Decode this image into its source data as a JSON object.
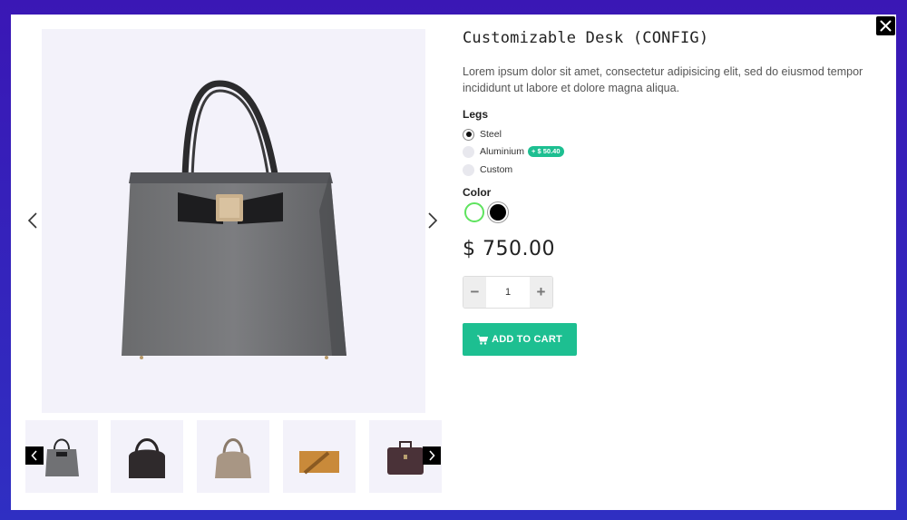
{
  "product": {
    "title": "Customizable Desk (CONFIG)",
    "description": "Lorem ipsum dolor sit amet, consectetur adipisicing elit, sed do eiusmod tempor incididunt ut labore et dolore magna aliqua.",
    "price": "$ 750.00"
  },
  "legs": {
    "label": "Legs",
    "options": [
      {
        "label": "Steel",
        "selected": true
      },
      {
        "label": "Aluminium",
        "badge": "+ $ 50.40",
        "selected": false
      },
      {
        "label": "Custom",
        "selected": false
      }
    ]
  },
  "color": {
    "label": "Color",
    "swatches": [
      {
        "name": "white",
        "hex": "#ffffff",
        "selected": true
      },
      {
        "name": "black",
        "hex": "#000000",
        "selected": false
      }
    ]
  },
  "quantity": {
    "minus": "−",
    "plus": "+",
    "value": "1"
  },
  "cart": {
    "label": "ADD TO CART"
  },
  "colors": {
    "accent": "#1dbf91",
    "background": "#3a17b5"
  },
  "icons": {
    "close": "close-icon",
    "prev": "chevron-left-icon",
    "next": "chevron-right-icon",
    "cart": "cart-icon"
  },
  "thumbnails": [
    "gray-tote-bag",
    "black-hobo-bag",
    "beige-hobo-bag",
    "tan-messenger-bag",
    "brown-briefcase"
  ]
}
